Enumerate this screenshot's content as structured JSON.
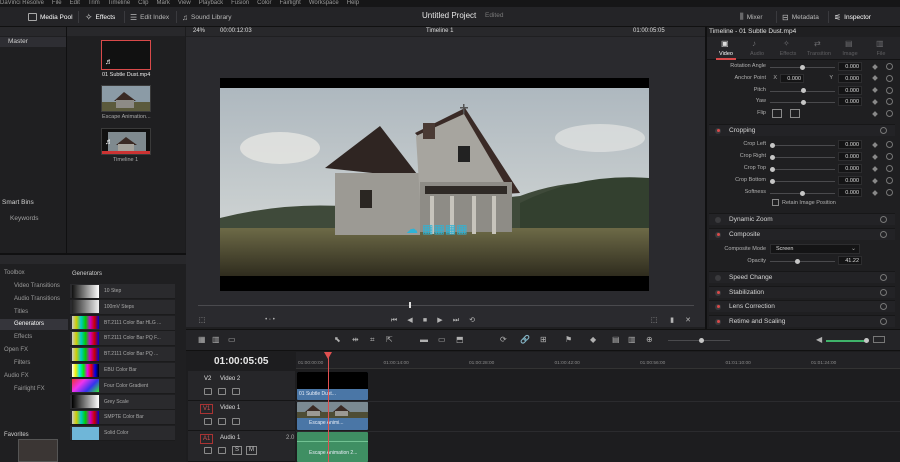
{
  "menubar": {
    "items": [
      "DaVinci Resolve",
      "File",
      "Edit",
      "Trim",
      "Timeline",
      "Clip",
      "Mark",
      "View",
      "Playback",
      "Fusion",
      "Color",
      "Fairlight",
      "Workspace",
      "Help"
    ]
  },
  "toolbar": {
    "media_pool": "Media Pool",
    "effects": "Effects",
    "edit_index": "Edit Index",
    "sound_library": "Sound Library",
    "project_title": "Untitled Project",
    "project_status": "Edited",
    "mixer": "Mixer",
    "metadata": "Metadata",
    "inspector": "Inspector"
  },
  "media_pool": {
    "bin_master": "Master",
    "smart_bins": "Smart Bins",
    "keywords": "Keywords",
    "favorites": "Favorites",
    "clips": [
      {
        "name": "01 Subtle Dust.mp4"
      },
      {
        "name": "Escape Animation..."
      },
      {
        "name": "Timeline 1"
      }
    ]
  },
  "viewer": {
    "zoom": "24%",
    "timecode_left": "00:00:12:03",
    "timeline_name": "Timeline 1",
    "timecode_right": "01:00:05:05",
    "dot_nav": "• ◦ •"
  },
  "effects_panel": {
    "tree": [
      {
        "label": "Toolbox",
        "level": 0
      },
      {
        "label": "Video Transitions",
        "level": 1
      },
      {
        "label": "Audio Transitions",
        "level": 1
      },
      {
        "label": "Titles",
        "level": 1
      },
      {
        "label": "Generators",
        "level": 1,
        "selected": true
      },
      {
        "label": "Effects",
        "level": 1
      },
      {
        "label": "Open FX",
        "level": 0
      },
      {
        "label": "Filters",
        "level": 1
      },
      {
        "label": "Audio FX",
        "level": 0
      },
      {
        "label": "Fairlight FX",
        "level": 1
      }
    ],
    "generators_title": "Generators",
    "generators": [
      {
        "name": "10 Step",
        "swatch": "linear-gradient(90deg,#111,#333,#555,#777,#999,#bbb,#ddd,#fff)"
      },
      {
        "name": "100mV Steps",
        "swatch": "linear-gradient(90deg,#222,#666,#aaa,#eee)"
      },
      {
        "name": "BT.2111 Color Bar HLG ...",
        "swatch": "linear-gradient(90deg,#ccc,#cc0,#0cc,#0c0,#c0c,#c00,#00c)"
      },
      {
        "name": "BT.2111 Color Bar PQ F...",
        "swatch": "linear-gradient(90deg,#ccc,#cc0,#0cc,#0c0,#c0c,#c00,#00c)"
      },
      {
        "name": "BT.2111 Color Bar PQ ...",
        "swatch": "linear-gradient(90deg,#ccc,#cc0,#0cc,#0c0,#c0c,#c00,#00c)"
      },
      {
        "name": "EBU Color Bar",
        "swatch": "linear-gradient(90deg,#fff,#ee0,#0ee,#0e0,#e0e,#e00,#00e,#000)"
      },
      {
        "name": "Four Color Gradient",
        "swatch": "linear-gradient(135deg,#e33,#e3e,#33e,#3e3)"
      },
      {
        "name": "Grey Scale",
        "swatch": "linear-gradient(90deg,#000,#fff)"
      },
      {
        "name": "SMPTE Color Bar",
        "swatch": "linear-gradient(90deg,#ccc,#cc0,#0cc,#0c0,#c0c,#c00,#00c)"
      },
      {
        "name": "Solid Color",
        "swatch": "#6fb6d8"
      }
    ]
  },
  "inspector": {
    "title": "Timeline - 01 Subtle Dust.mp4",
    "tabs": [
      "Video",
      "Audio",
      "Effects",
      "Transition",
      "Image",
      "File"
    ],
    "transform_rows": [
      {
        "label": "Rotation Angle",
        "value": "0.000"
      },
      {
        "label": "Anchor Point",
        "x_label": "X",
        "x_value": "0.000",
        "y_label": "Y",
        "value": "0.000"
      },
      {
        "label": "Pitch",
        "value": "0.000"
      },
      {
        "label": "Yaw",
        "value": "0.000"
      },
      {
        "label": "Flip"
      }
    ],
    "cropping_title": "Cropping",
    "crop_rows": [
      {
        "label": "Crop Left",
        "value": "0.000"
      },
      {
        "label": "Crop Right",
        "value": "0.000"
      },
      {
        "label": "Crop Top",
        "value": "0.000"
      },
      {
        "label": "Crop Bottom",
        "value": "0.000"
      },
      {
        "label": "Softness",
        "value": "0.000"
      }
    ],
    "retain_label": "Retain Image Position",
    "dynamic_zoom": "Dynamic Zoom",
    "composite_title": "Composite",
    "composite_mode_label": "Composite Mode",
    "composite_mode_value": "Screen",
    "opacity_label": "Opacity",
    "opacity_value": "41.22",
    "speed_change": "Speed Change",
    "stabilization": "Stabilization",
    "lens_correction": "Lens Correction",
    "retime_scaling": "Retime and Scaling"
  },
  "timeline": {
    "timecode": "01:00:05:05",
    "ruler": [
      "01:00:00:00",
      "01:00:14:00",
      "01:00:28:00",
      "01:00:42:00",
      "01:00:56:00",
      "01:01:10:00",
      "01:01:24:00"
    ],
    "tracks": [
      {
        "tag": "V2",
        "name": "Video 2"
      },
      {
        "tag": "V1",
        "name": "Video 1"
      },
      {
        "tag": "A1",
        "name": "Audio 1",
        "channels": "2.0"
      }
    ],
    "clips": [
      {
        "label": "01 Subtle Dust..."
      },
      {
        "label": "Escape Animi..."
      },
      {
        "label": "Escape Animation 2..."
      }
    ]
  },
  "colors": {
    "accent_red": "#d94a4a",
    "video_clip_blue": "#4a76a6",
    "audio_clip_green": "#3f8f63",
    "playhead": "#e05050"
  }
}
